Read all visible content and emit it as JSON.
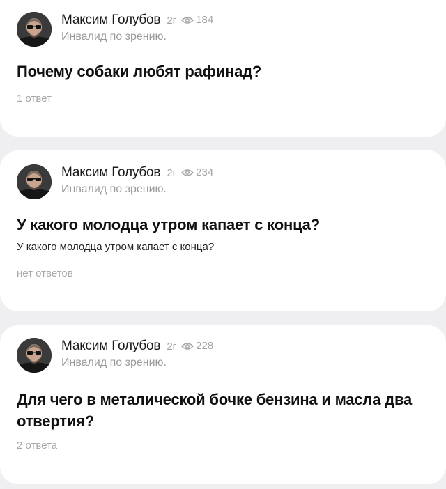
{
  "questions": [
    {
      "author": {
        "name": "Максим Голубов",
        "age": "2г",
        "status": "Инвалид по зрению."
      },
      "views": "184",
      "title": "Почему собаки любят рафинад?",
      "body": "",
      "answers": "1 ответ"
    },
    {
      "author": {
        "name": "Максим Голубов",
        "age": "2г",
        "status": "Инвалид по зрению."
      },
      "views": "234",
      "title": "У какого молодца утром капает с конца?",
      "body": "У какого молодца утром капает с конца?",
      "answers": "нет ответов"
    },
    {
      "author": {
        "name": "Максим Голубов",
        "age": "2г",
        "status": "Инвалид по зрению."
      },
      "views": "228",
      "title": "Для чего в металической бочке бензина и масла два отвертия?",
      "body": "",
      "answers": "2 ответа"
    }
  ],
  "icons": {
    "views": "eye-icon",
    "avatar": "user-avatar-photo"
  },
  "colors": {
    "background": "#efeff1",
    "card": "#ffffff",
    "muted": "#a3a3a3"
  }
}
